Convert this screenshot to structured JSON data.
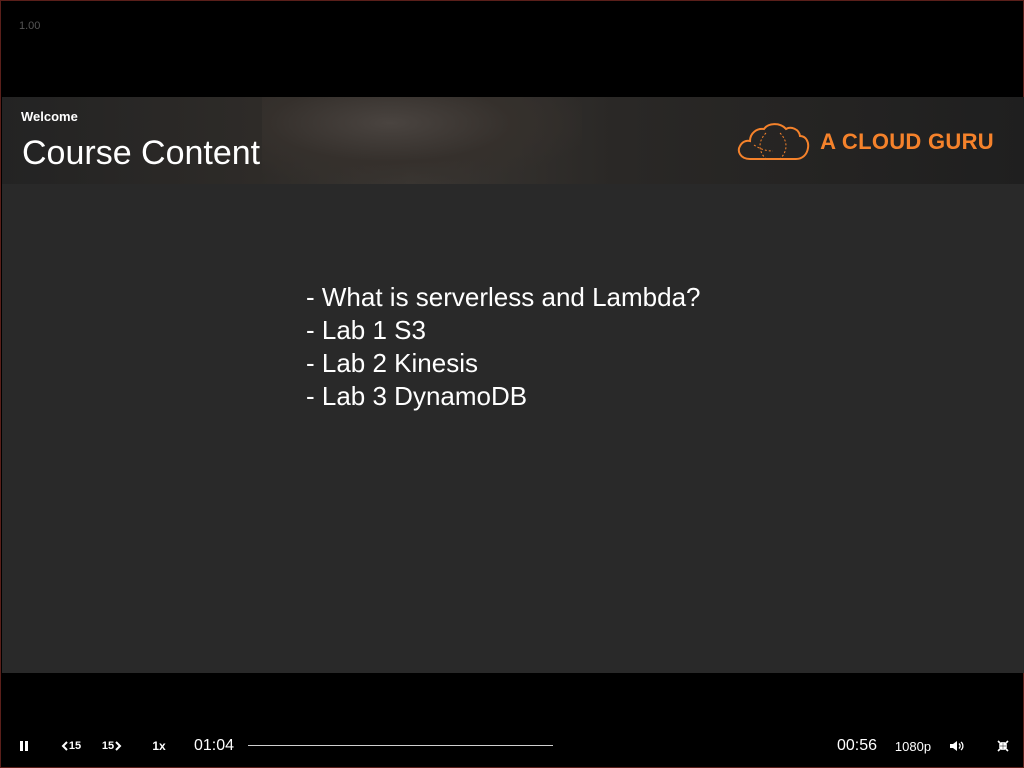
{
  "player": {
    "version_label": "1.00"
  },
  "banner": {
    "kicker": "Welcome",
    "title": "Course Content",
    "logo_text": "A CLOUD GURU",
    "logo_color": "#f5822b"
  },
  "slide": {
    "bullets": [
      "- What is serverless and Lambda?",
      "- Lab 1 S3",
      "- Lab 2 Kinesis",
      "- Lab 3 DynamoDB"
    ]
  },
  "controls": {
    "play_pause_icon": "pause-icon",
    "rewind_label": "15",
    "forward_label": "15",
    "playback_rate": "1x",
    "elapsed_time": "01:04",
    "remaining_time": "00:56",
    "quality": "1080p",
    "volume_icon": "volume-icon",
    "fullscreen_icon": "exit-fullscreen-icon"
  }
}
